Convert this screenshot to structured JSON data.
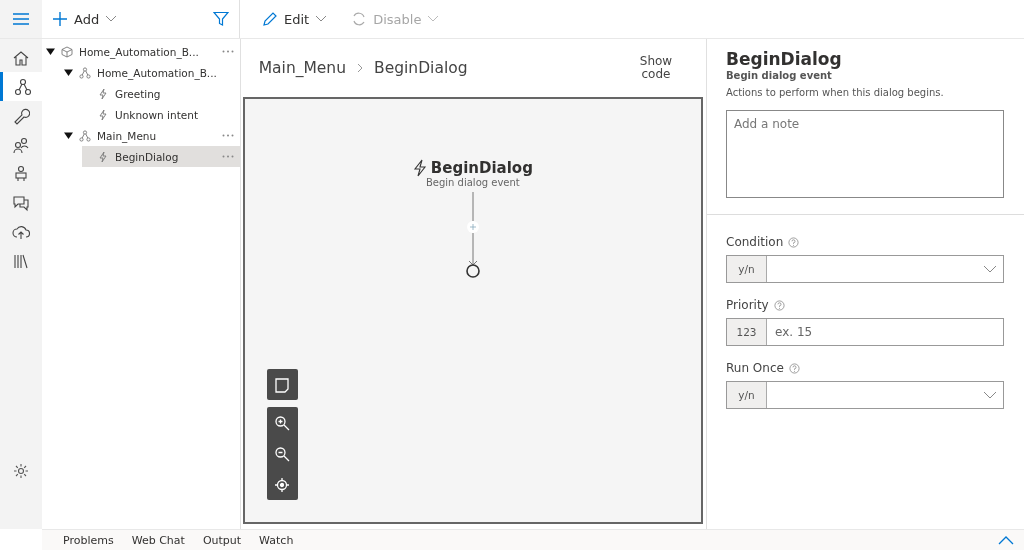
{
  "rail": [
    {
      "kind": "home",
      "selected": false
    },
    {
      "kind": "dialogs",
      "selected": true
    },
    {
      "kind": "wrench",
      "selected": false
    },
    {
      "kind": "users",
      "selected": false
    },
    {
      "kind": "bot",
      "selected": false
    },
    {
      "kind": "chat",
      "selected": false
    },
    {
      "kind": "publish",
      "selected": false
    },
    {
      "kind": "library",
      "selected": false
    }
  ],
  "add_button": "Add",
  "toolbar": [
    {
      "label": "Edit",
      "kind": "edit",
      "disabled": false
    },
    {
      "label": "Disable",
      "kind": "disable",
      "disabled": true
    }
  ],
  "tree": [
    {
      "label": "Home_Automation_B...",
      "kind": "bot",
      "expanded": true,
      "selected": false,
      "more": true,
      "children": [
        {
          "label": "Home_Automation_B...",
          "kind": "dialog",
          "expanded": true,
          "selected": false,
          "more": false,
          "children": [
            {
              "label": "Greeting",
              "kind": "trigger",
              "selected": false,
              "more": false
            },
            {
              "label": "Unknown intent",
              "kind": "trigger",
              "selected": false,
              "more": false
            }
          ]
        },
        {
          "label": "Main_Menu",
          "kind": "dialog",
          "expanded": true,
          "selected": false,
          "more": true,
          "children": [
            {
              "label": "BeginDialog",
              "kind": "trigger",
              "selected": true,
              "more": true
            }
          ]
        }
      ]
    }
  ],
  "breadcrumb": [
    "Main_Menu",
    "BeginDialog"
  ],
  "show_code": "Show code",
  "canvas": {
    "node_title": "BeginDialog",
    "node_subtitle": "Begin dialog event"
  },
  "properties": {
    "title": "BeginDialog",
    "subtitle": "Begin dialog event",
    "description": "Actions to perform when this dialog begins.",
    "note_placeholder": "Add a note",
    "fields": [
      {
        "label": "Condition",
        "prefix": "y/n",
        "kind": "dropdown"
      },
      {
        "label": "Priority",
        "prefix": "123",
        "kind": "number",
        "placeholder": "ex. 15"
      },
      {
        "label": "Run Once",
        "prefix": "y/n",
        "kind": "dropdown"
      }
    ]
  },
  "bottom_tabs": [
    "Problems",
    "Web Chat",
    "Output",
    "Watch"
  ]
}
